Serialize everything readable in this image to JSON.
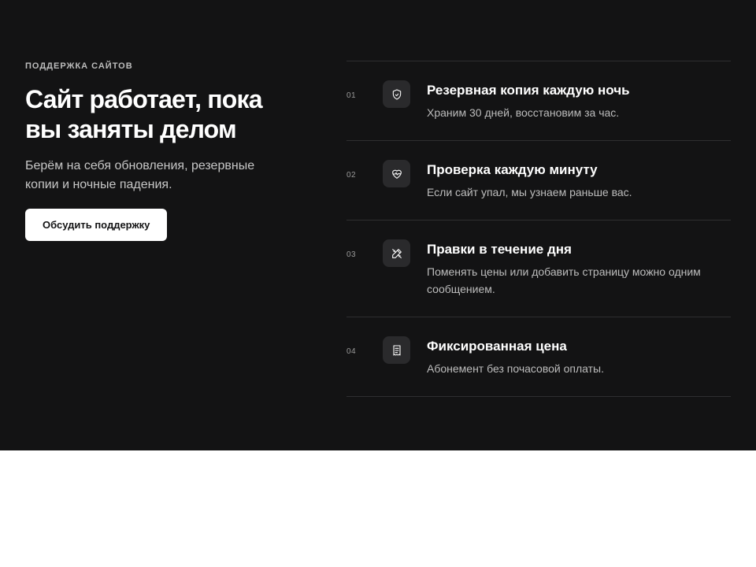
{
  "hero": {
    "eyebrow": "ПОДДЕРЖКА САЙТОВ",
    "title_line1": "Сайт работает, пока",
    "title_line2": "вы заняты делом",
    "lead_line1": "Берём на себя обновления, резервные",
    "lead_line2": "копии и ночные падения.",
    "cta_label": "Обсудить поддержку"
  },
  "features": [
    {
      "num": "01",
      "icon": "shield-icon",
      "title": "Резервная копия каждую ночь",
      "desc": "Храним 30 дней, восстановим за час."
    },
    {
      "num": "02",
      "icon": "heart-pulse-icon",
      "title": "Проверка каждую минуту",
      "desc": "Если сайт упал, мы узнаем раньше вас."
    },
    {
      "num": "03",
      "icon": "pencil-ruler-icon",
      "title": "Правки в течение дня",
      "desc": "Поменять цены или добавить страницу можно одним сообщением."
    },
    {
      "num": "04",
      "icon": "receipt-icon",
      "title": "Фиксированная цена",
      "desc": "Абонемент без почасовой оплаты."
    }
  ],
  "colors": {
    "background": "#131314",
    "divider": "#2e2e30",
    "icon_tile": "#2a2a2c",
    "text_primary": "#ffffff",
    "text_secondary": "#bdbdbd",
    "button_bg": "#ffffff",
    "button_text": "#131314",
    "page_bg": "#ffffff"
  }
}
